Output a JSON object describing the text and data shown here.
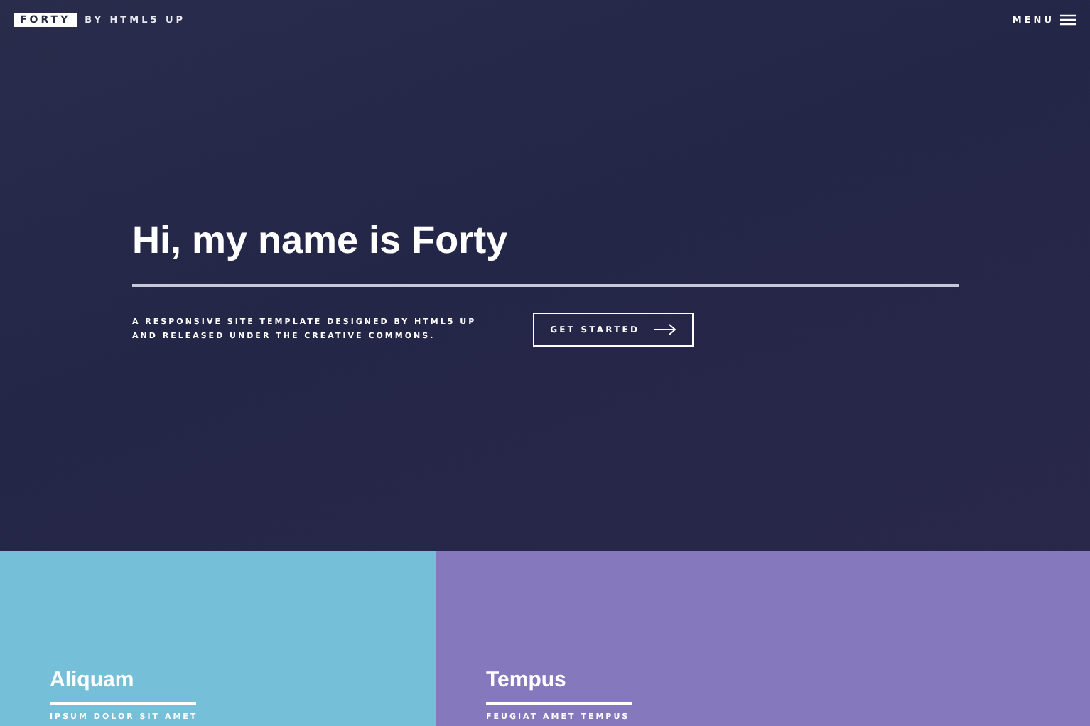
{
  "header": {
    "logo": "FORTY",
    "tagline": "BY HTML5 UP",
    "menu": "MENU"
  },
  "banner": {
    "title": "Hi, my name is Forty",
    "description": "A RESPONSIVE SITE TEMPLATE DESIGNED BY HTML5 UP\nAND RELEASED UNDER THE CREATIVE COMMONS.",
    "button": "GET STARTED"
  },
  "tiles": [
    {
      "title": "Aliquam",
      "subtitle": "IPSUM DOLOR SIT AMET",
      "color": "#76bfd9"
    },
    {
      "title": "Tempus",
      "subtitle": "FEUGIAT AMET TEMPUS",
      "color": "#8678bd"
    }
  ]
}
